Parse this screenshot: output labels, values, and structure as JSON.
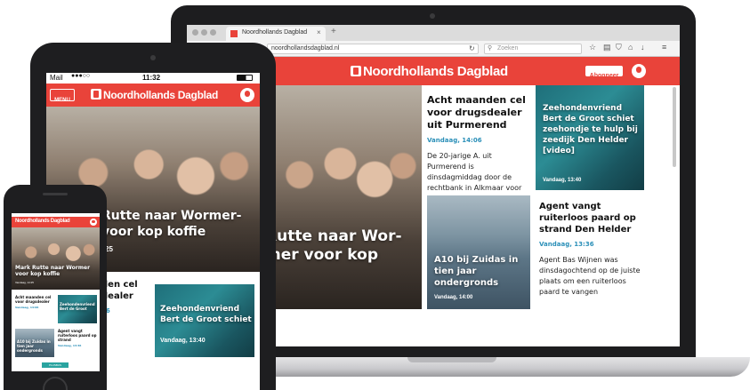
{
  "laptop": {
    "tab_title": "Noordhollands Dagblad",
    "url": "noordhollandsdagblad.nl",
    "search_placeholder": "Zoeken",
    "logo": "Noordhollands Dagblad",
    "subscribe": "Abonneer",
    "hero_title": "Rutte naar Wor-\nmer voor kop",
    "article1": {
      "title": "Acht maanden cel voor drugsdealer uit Purmerend",
      "date": "Vandaag, 14:06",
      "text": "De 20-jarige A. uit Purmerend is dinsdagmiddag door de rechtbank in Alkmaar voor"
    },
    "article2": {
      "title": "Zeehondenvriend Bert de Groot schiet zeehondje te hulp bij zeedijk Den Helder [video]",
      "date": "Vandaag, 13:40"
    },
    "article3": {
      "title": "A10 bij Zuidas in tien jaar ondergronds",
      "date": "Vandaag, 14:00"
    },
    "article4": {
      "title": "Agent vangt ruiterloos paard op strand Den Helder",
      "date": "Vandaag, 13:36",
      "text": "Agent Bas Wijnen was dinsdagochtend op de juiste plaats om een ruiterloos paard te vangen"
    }
  },
  "tablet": {
    "carrier": "Mail",
    "time": "11:32",
    "menu": "MENU",
    "logo": "Noordhollands Dagblad",
    "hero_title": "Rutte naar Wormer-\nvoor kop koffie",
    "hero_date": "25",
    "article1_title": "den cel\ndealer",
    "article1_date": "06",
    "article2_title": "Zeehondenvriend\nBert de Groot schiet",
    "article2_date": "Vandaag, 13:40"
  },
  "phone": {
    "logo": "Noordhollands Dagblad",
    "hero_title": "Mark Rutte naar Wormer voor kop koffie",
    "hero_date": "Vandaag, 14:25",
    "article1_title": "Acht maanden cel voor drugsdealer",
    "article1_date": "Vandaag, 14:06",
    "article2_title": "Zeehondenvriend Bert de Groot",
    "article3_title": "A10 bij Zuidas in tien jaar ondergronds",
    "article4_title": "Agent vangt ruiterloos paard op strand",
    "article4_date": "Vandaag, 13:36",
    "footer_btn": "PLUSBUS"
  },
  "colors": {
    "brand_red": "#e9433a",
    "date_blue": "#2a8fb8"
  }
}
